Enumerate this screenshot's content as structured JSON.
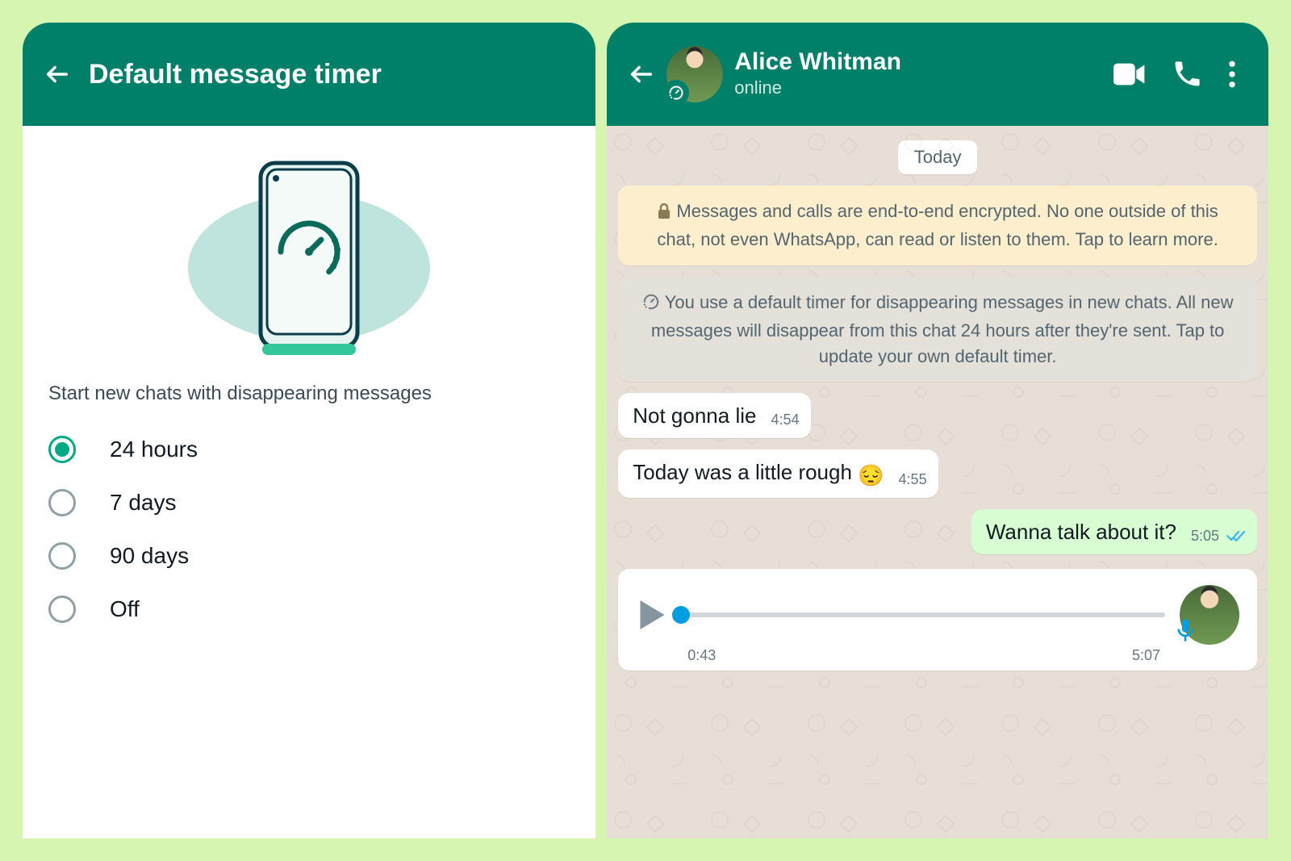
{
  "colors": {
    "teal": "#008069",
    "accent": "#00a884"
  },
  "left": {
    "header": {
      "title": "Default message timer"
    },
    "section_label": "Start new chats with disappearing messages",
    "options": [
      {
        "label": "24 hours",
        "selected": true
      },
      {
        "label": "7 days",
        "selected": false
      },
      {
        "label": "90 days",
        "selected": false
      },
      {
        "label": "Off",
        "selected": false
      }
    ]
  },
  "right": {
    "header": {
      "contact_name": "Alice Whitman",
      "status": "online"
    },
    "date_label": "Today",
    "encryption_notice": "Messages and calls are end-to-end encrypted. No one outside of this chat, not even WhatsApp, can read or listen to them. Tap to learn more.",
    "timer_notice": "You use a default timer for disappearing messages in new chats. All new messages will disappear from this chat 24 hours after they're sent. Tap to update your own default timer.",
    "messages": [
      {
        "dir": "in",
        "text": "Not gonna lie",
        "time": "4:54"
      },
      {
        "dir": "in",
        "text": "Today was a little rough ",
        "emoji": "😔",
        "time": "4:55"
      },
      {
        "dir": "out",
        "text": "Wanna talk about it?",
        "time": "5:05",
        "read": true
      }
    ],
    "voice": {
      "elapsed": "0:43",
      "total": "5:07"
    }
  }
}
